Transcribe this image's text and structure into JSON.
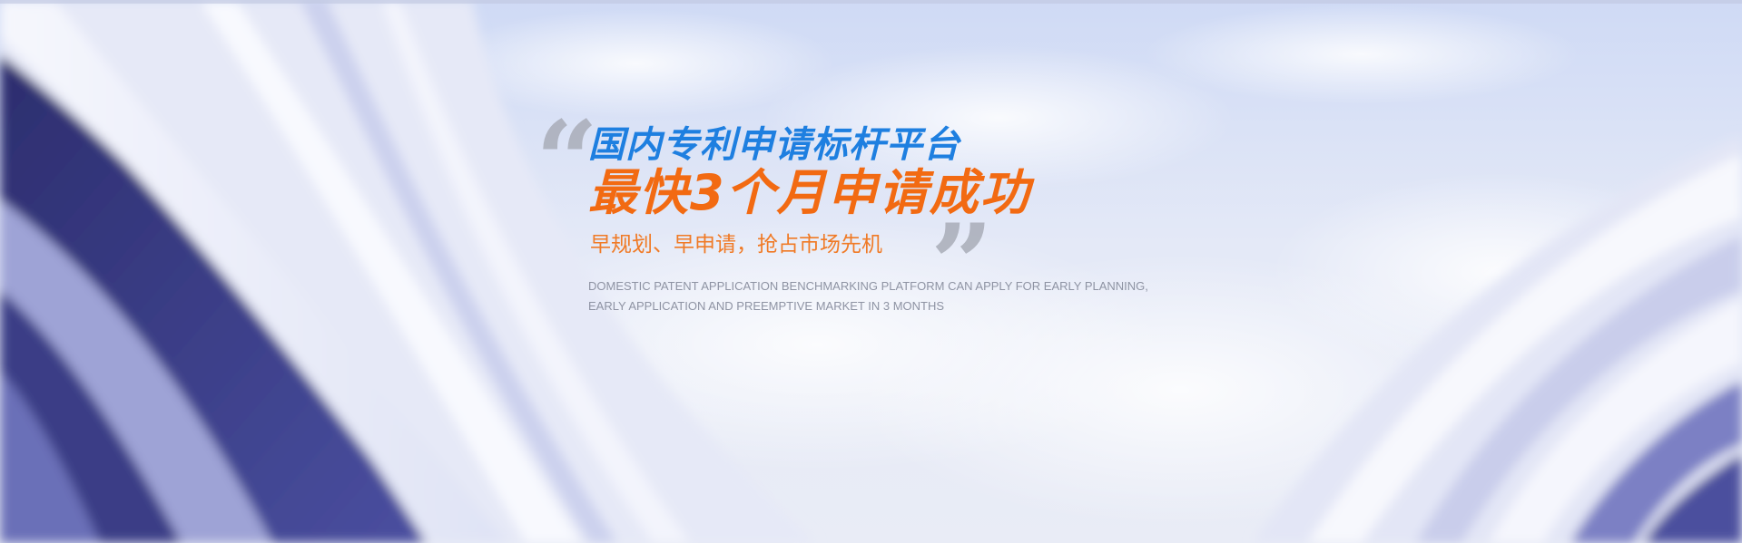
{
  "banner": {
    "title_line1": "国内专利申请标杆平台",
    "title_line2": "最快3个月申请成功",
    "subtitle": "早规划、早申请，抢占市场先机",
    "english_line1": "DOMESTIC PATENT APPLICATION BENCHMARKING PLATFORM CAN APPLY FOR EARLY PLANNING,",
    "english_line2": " EARLY APPLICATION AND PREEMPTIVE MARKET IN 3 MONTHS",
    "quote_open": "“",
    "quote_close": "”"
  },
  "colors": {
    "title_blue": "#1e7fe0",
    "title_orange": "#f26a12",
    "subtitle_orange": "#f07a26",
    "quote_gray": "#a9adb8",
    "english_gray": "#8e93a3"
  }
}
